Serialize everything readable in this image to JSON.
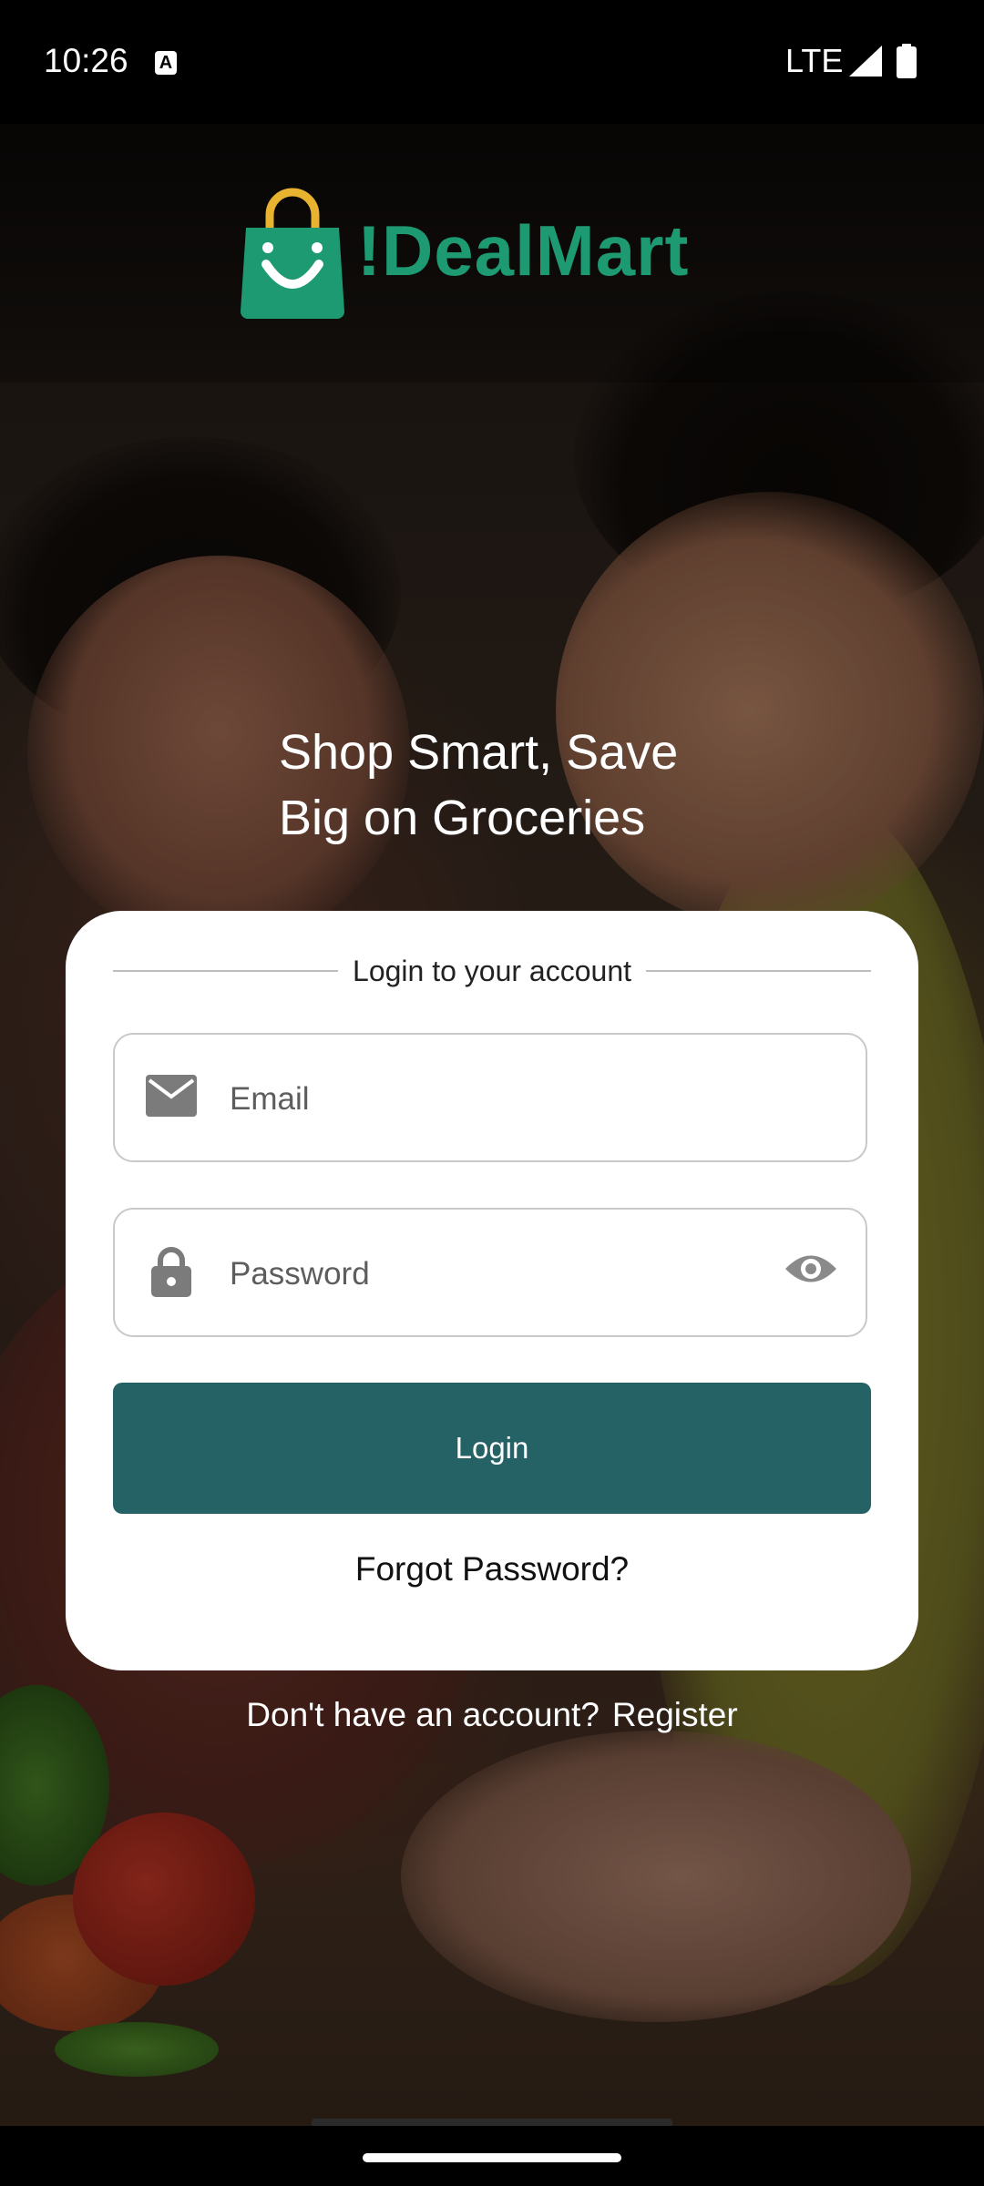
{
  "status_bar": {
    "time": "10:26",
    "notification_icon": "A",
    "network": "LTE"
  },
  "brand": {
    "name": "!DealMart",
    "logo_icon": "shopping-bag-smile-icon",
    "brand_color": "#1d9a72"
  },
  "hero": {
    "tagline_line1": "Shop Smart, Save",
    "tagline_line2": "Big on Groceries"
  },
  "login_card": {
    "heading": "Login to your account",
    "email": {
      "placeholder": "Email",
      "value": "",
      "icon": "mail-icon"
    },
    "password": {
      "placeholder": "Password",
      "value": "",
      "icon": "lock-icon",
      "toggle_icon": "eye-icon"
    },
    "login_label": "Login",
    "forgot_label": "Forgot Password?",
    "accent_color": "#256265"
  },
  "footer": {
    "prompt": "Don't have an account?",
    "register_label": "Register"
  }
}
